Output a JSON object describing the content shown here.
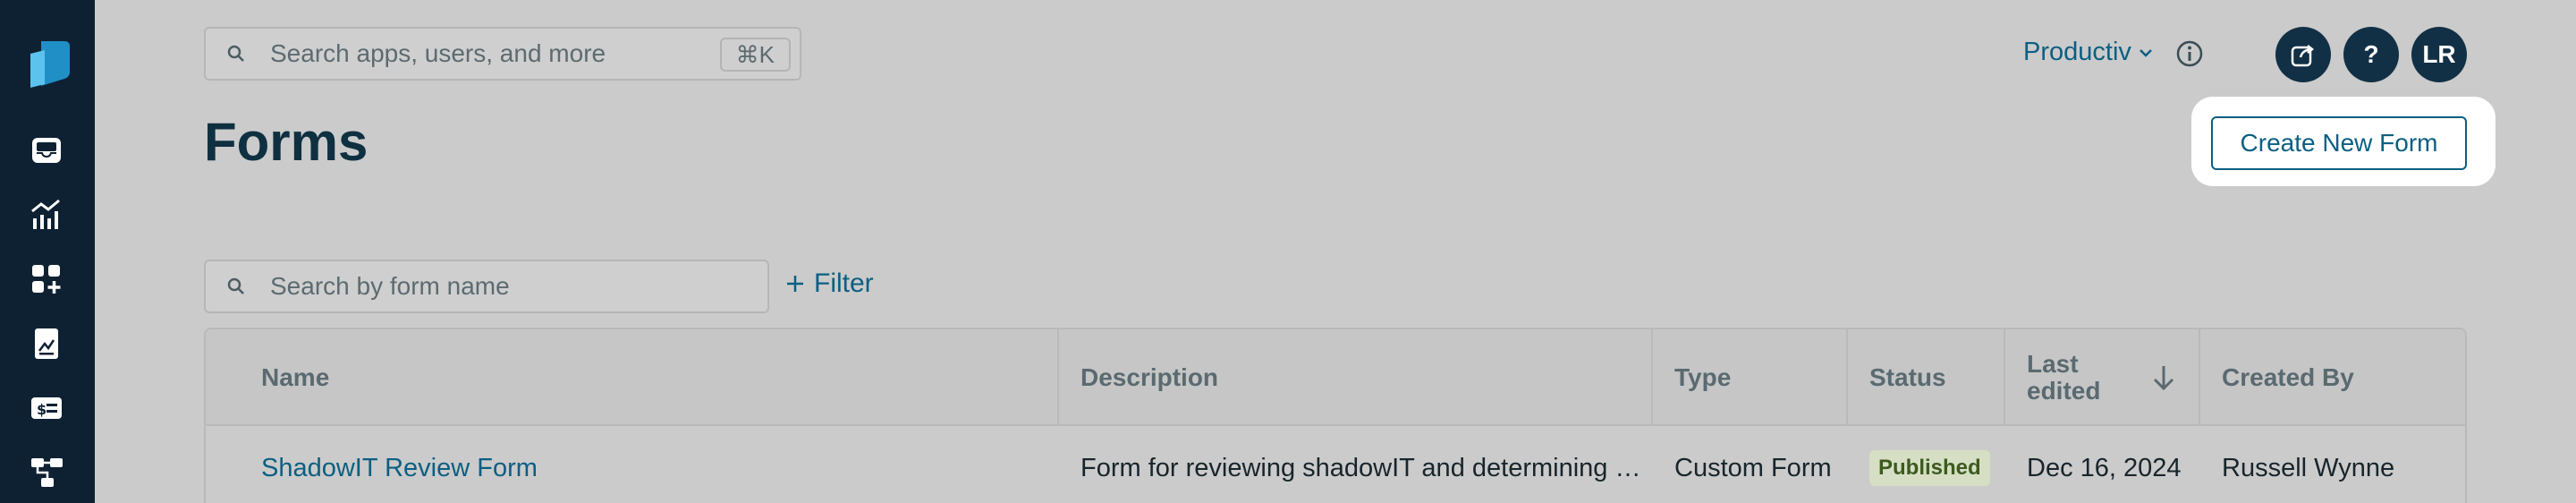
{
  "sidebar": {
    "icons": [
      "logo-icon",
      "inbox-icon",
      "analytics-icon",
      "apps-add-icon",
      "documents-icon",
      "billing-icon",
      "workflow-icon"
    ]
  },
  "top_search": {
    "placeholder": "Search apps, users, and more",
    "shortcut": "⌘K"
  },
  "header": {
    "workspace": "Productiv",
    "share_icon": "share-icon",
    "help_label": "?",
    "avatar_initials": "LR"
  },
  "page": {
    "title": "Forms",
    "create_button": "Create New Form"
  },
  "form_search": {
    "placeholder": "Search by form name",
    "filter_label": "Filter"
  },
  "table": {
    "columns": [
      "Name",
      "Description",
      "Type",
      "Status",
      "Last edited",
      "Created By"
    ],
    "last_edited_line1": "Last",
    "last_edited_line2": "edited",
    "rows": [
      {
        "name": "ShadowIT Review Form",
        "description": "Form for reviewing shadowIT and determining …",
        "type": "Custom Form",
        "status": "Published",
        "last_edited": "Dec 16, 2024",
        "created_by": "Russell Wynne"
      }
    ]
  },
  "colors": {
    "sidebar_bg": "#0e2133",
    "accent": "#0b5f82",
    "published_badge_bg": "#d6dfc4"
  }
}
